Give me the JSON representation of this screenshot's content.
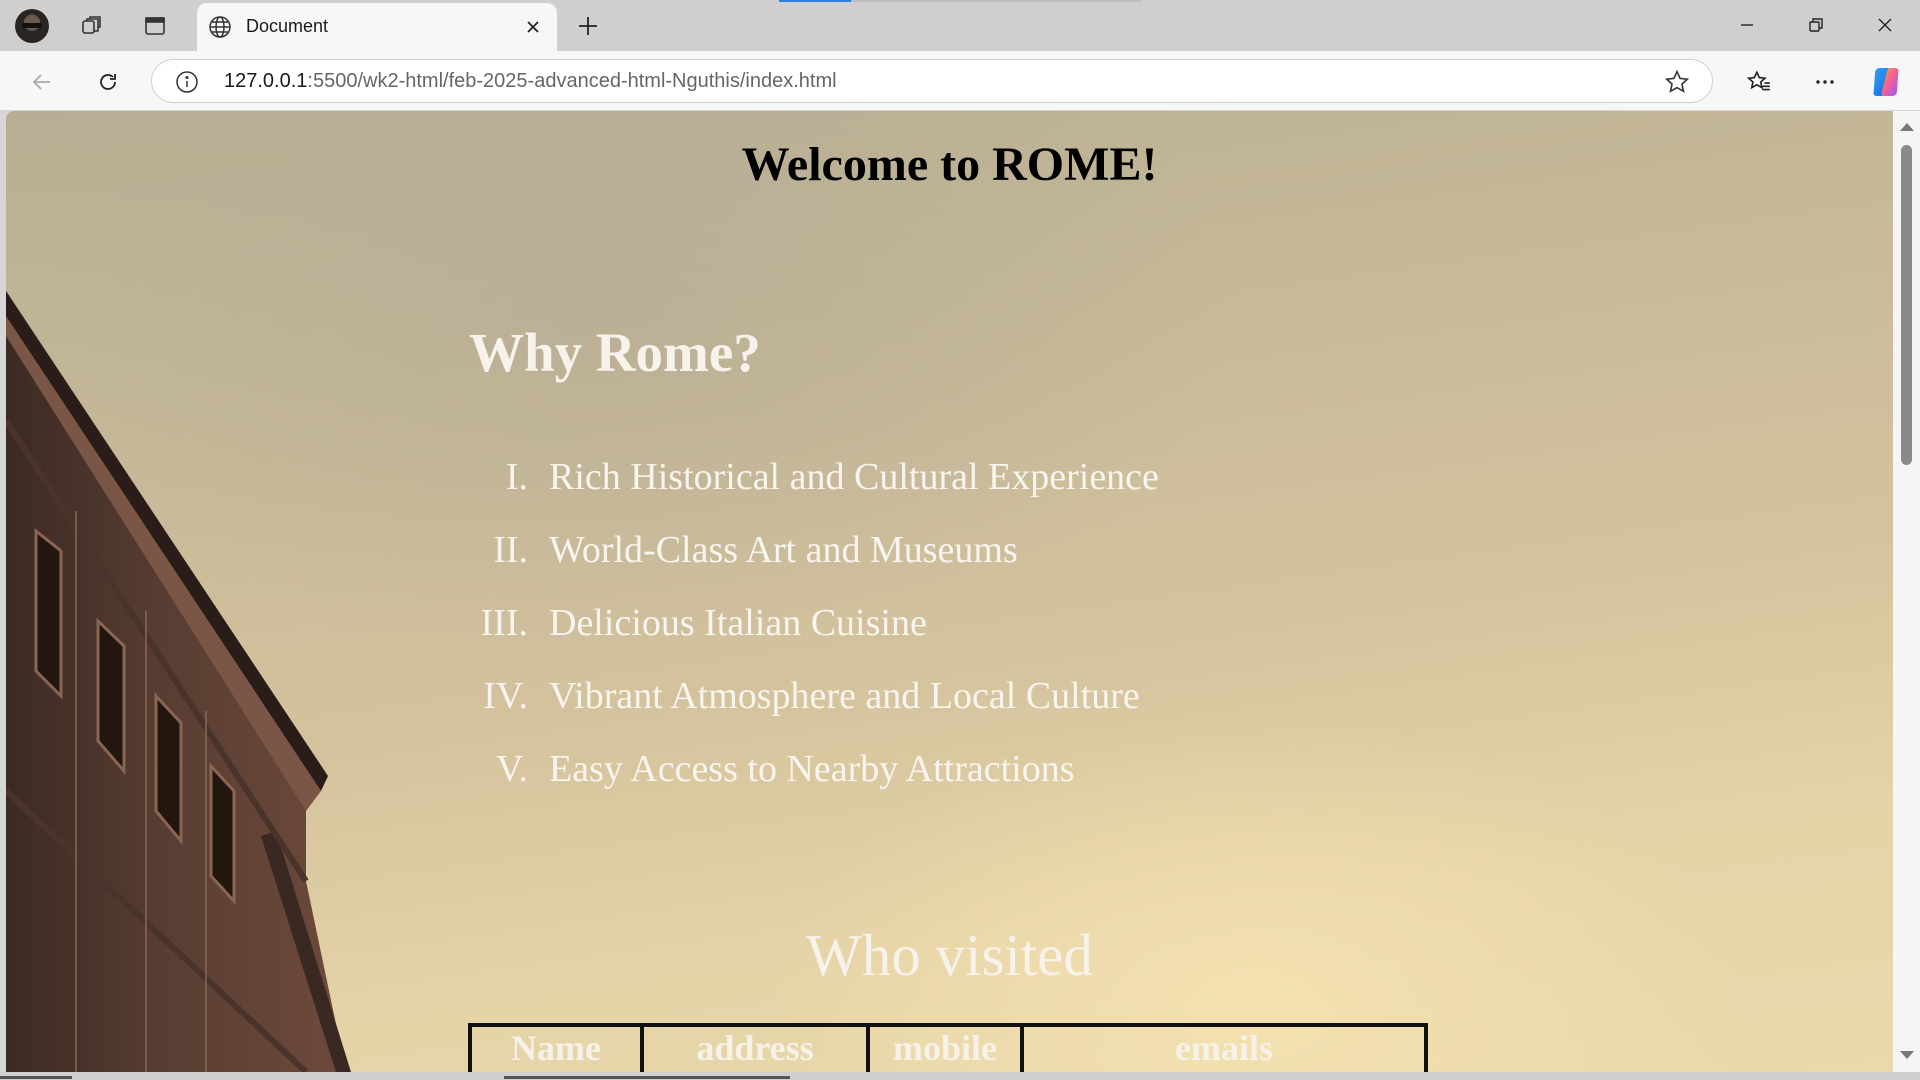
{
  "browser": {
    "tab": {
      "title": "Document",
      "icon": "globe-icon"
    },
    "address": {
      "host": "127.0.0.1",
      "rest": ":5500/wk2-html/feb-2025-advanced-html-Nguthis/index.html"
    },
    "icons": {
      "profile": "avatar",
      "workspaces": "workspaces-icon",
      "tab_actions": "vertical-tabs-icon",
      "new_tab": "plus-icon",
      "back": "back-arrow-icon",
      "refresh": "refresh-icon",
      "site_info": "info-icon",
      "favorite": "star-icon",
      "favorites": "favorites-icon",
      "more": "more-icon",
      "copilot": "copilot-icon",
      "minimize": "minimize-icon",
      "restore": "restore-icon",
      "close": "close-icon"
    },
    "accent": "#2f7de1"
  },
  "page": {
    "heading": "Welcome to ROME!",
    "why_heading": "Why Rome?",
    "reasons": [
      {
        "num": "I.",
        "text": "Rich Historical and Cultural Experience"
      },
      {
        "num": "II.",
        "text": "World-Class Art and Museums"
      },
      {
        "num": "III.",
        "text": "Delicious Italian Cuisine"
      },
      {
        "num": "IV.",
        "text": "Vibrant Atmosphere and Local Culture"
      },
      {
        "num": "V.",
        "text": "Easy Access to Nearby Attractions"
      }
    ],
    "visited_heading": "Who visited",
    "table": {
      "headers": [
        "Name",
        "address",
        "mobile",
        "emails"
      ]
    },
    "colors": {
      "heading": "#000000",
      "light_text": "#f7f3ea"
    }
  }
}
